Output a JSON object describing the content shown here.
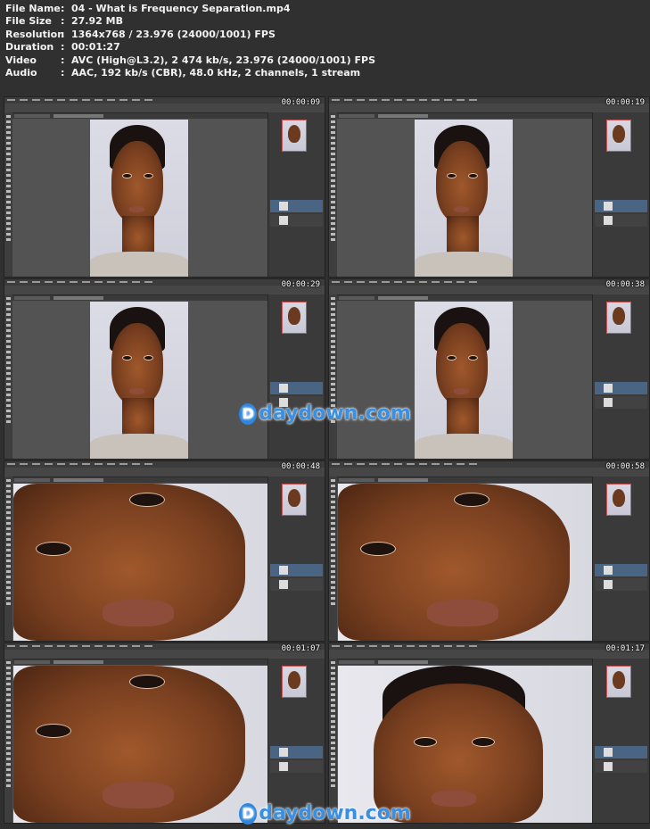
{
  "file_info": [
    {
      "key": "File Name",
      "value": "04 - What is Frequency Separation.mp4"
    },
    {
      "key": "File Size",
      "value": "27.92 MB"
    },
    {
      "key": "Resolution",
      "value": "1364x768 / 23.976 (24000/1001) FPS"
    },
    {
      "key": "Duration",
      "value": "00:01:27"
    },
    {
      "key": "Video",
      "value": "AVC (High@L3.2), 2 474 kb/s, 23.976 (24000/1001) FPS"
    },
    {
      "key": "Audio",
      "value": "AAC, 192 kb/s (CBR), 48.0 kHz, 2 channels, 1 stream"
    }
  ],
  "separator": ":",
  "frames": [
    {
      "timestamp": "00:00:09",
      "view": "full"
    },
    {
      "timestamp": "00:00:19",
      "view": "full"
    },
    {
      "timestamp": "00:00:29",
      "view": "full"
    },
    {
      "timestamp": "00:00:38",
      "view": "full"
    },
    {
      "timestamp": "00:00:48",
      "view": "zoom"
    },
    {
      "timestamp": "00:00:58",
      "view": "zoom"
    },
    {
      "timestamp": "00:01:07",
      "view": "zoom"
    },
    {
      "timestamp": "00:01:17",
      "view": "zoom2"
    }
  ],
  "watermark": {
    "letter": "D",
    "text": "daydown.com"
  }
}
